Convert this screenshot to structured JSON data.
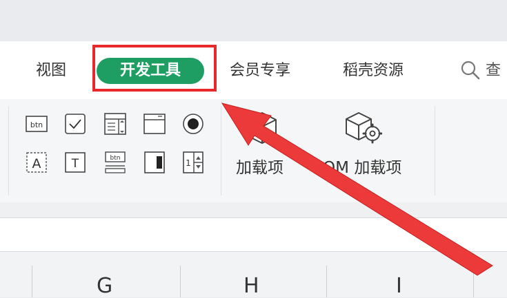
{
  "tabs": [
    {
      "label": "视图"
    },
    {
      "label": "开发工具",
      "active": true
    },
    {
      "label": "会员专享"
    },
    {
      "label": "稻壳资源"
    }
  ],
  "search": {
    "label": "查"
  },
  "ribbon": {
    "controls_row1": [
      "button-control-icon",
      "checkbox-control-icon",
      "combo-box-control-icon",
      "list-box-control-icon",
      "option-button-icon"
    ],
    "controls_row2": [
      "label-control-icon",
      "textbox-control-icon",
      "toggle-button-icon",
      "scrollbar-control-icon",
      "spinner-control-icon"
    ],
    "addins_label": "加载项",
    "com_addins_label": "COM 加载项",
    "btn_text": "btn",
    "label_text": "A",
    "text_text": "T",
    "spinner_text": "1"
  },
  "columns": [
    "G",
    "H",
    "I"
  ],
  "colors": {
    "accent": "#1e9e62",
    "highlight": "#e8282b"
  }
}
